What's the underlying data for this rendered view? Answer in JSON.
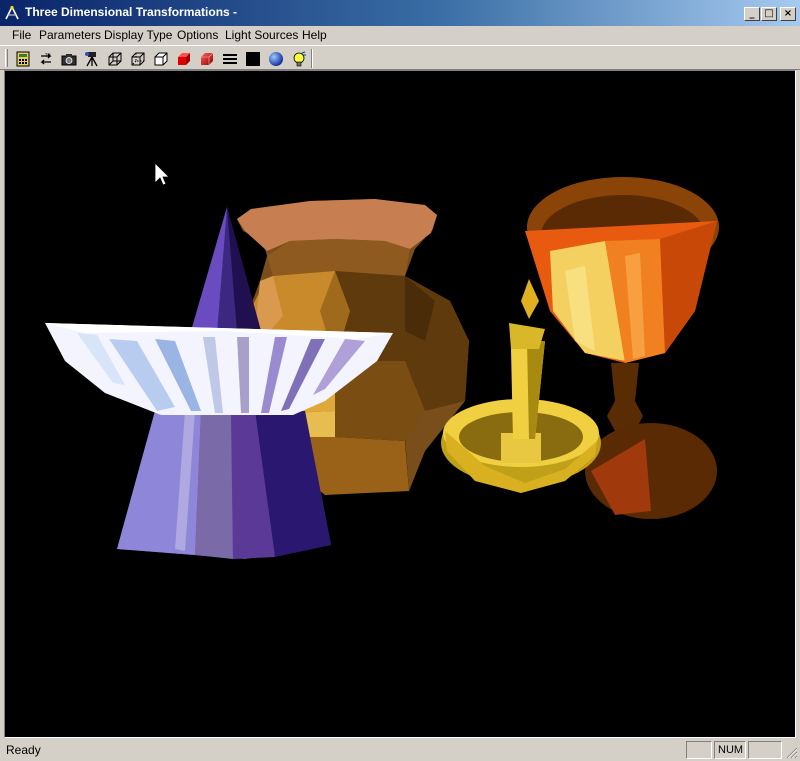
{
  "window": {
    "title": "Three Dimensional Transformations -",
    "app_icon": "compass-icon",
    "minimize_glyph": "_",
    "maximize_glyph": "□",
    "close_glyph": "×"
  },
  "menu": {
    "items": [
      "File",
      "Parameters",
      "Display Type",
      "Options",
      "Light Sources",
      "Help"
    ]
  },
  "toolbar": {
    "icons": [
      "calculator-icon",
      "refresh-icon",
      "camera-icon",
      "tripod-icon",
      "wireframe-cube-icon",
      "hidden-line-cube-icon",
      "outline-cube-icon",
      "flat-shaded-cube-icon",
      "gouraud-shaded-cube-icon",
      "line-style-icon",
      "background-color-icon",
      "sphere-icon",
      "light-bulb-icon"
    ]
  },
  "scene": {
    "background": "#000000",
    "objects": [
      "pitcher-vase",
      "cone",
      "bowl-on-stand",
      "candlestick",
      "goblet"
    ]
  },
  "status": {
    "text": "Ready",
    "num_indicator": "NUM"
  },
  "colors": {
    "title_gradient_start": "#0a246a",
    "title_gradient_end": "#a6caf0",
    "chrome": "#d4d0c8"
  }
}
